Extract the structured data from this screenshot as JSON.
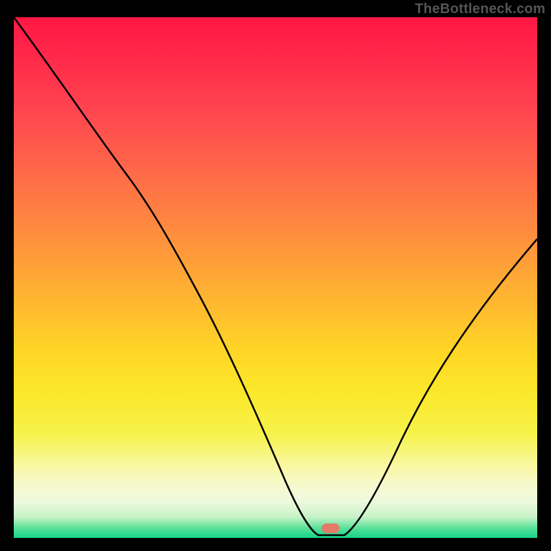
{
  "watermark": "TheBottleneck.com",
  "marker": {
    "x_frac": 0.605,
    "y_frac": 0.982
  },
  "chart_data": {
    "type": "line",
    "title": "",
    "xlabel": "",
    "ylabel": "",
    "xlim": [
      0,
      1
    ],
    "ylim": [
      0,
      1
    ],
    "series": [
      {
        "name": "curve",
        "x": [
          0.0,
          0.05,
          0.1,
          0.15,
          0.2,
          0.25,
          0.3,
          0.35,
          0.4,
          0.45,
          0.5,
          0.55,
          0.58,
          0.6,
          0.63,
          0.65,
          0.7,
          0.75,
          0.8,
          0.85,
          0.9,
          0.95,
          1.0
        ],
        "y": [
          1.0,
          0.93,
          0.86,
          0.79,
          0.71,
          0.62,
          0.53,
          0.44,
          0.35,
          0.26,
          0.17,
          0.07,
          0.01,
          0.0,
          0.0,
          0.02,
          0.1,
          0.2,
          0.3,
          0.39,
          0.46,
          0.52,
          0.57
        ]
      }
    ],
    "annotations": [
      {
        "type": "marker",
        "shape": "pill",
        "color": "#e47a6a",
        "x": 0.605,
        "y": 0.0
      }
    ],
    "background_gradient": {
      "direction": "top-to-bottom",
      "stops": [
        {
          "pos": 0.0,
          "color": "#ff1744"
        },
        {
          "pos": 0.5,
          "color": "#ffb531"
        },
        {
          "pos": 0.8,
          "color": "#f6f24a"
        },
        {
          "pos": 1.0,
          "color": "#14d48a"
        }
      ]
    }
  }
}
